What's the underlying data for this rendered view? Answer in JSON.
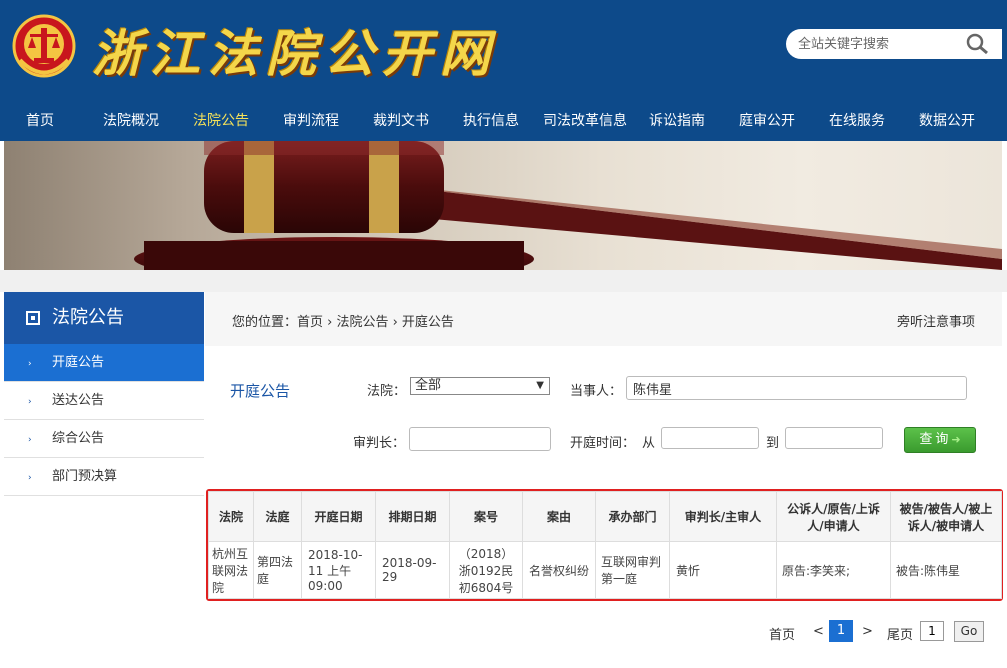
{
  "header": {
    "site_title": "浙江法院公开网",
    "search_placeholder": "全站关键字搜索"
  },
  "nav": [
    {
      "label": "首页"
    },
    {
      "label": "法院概况"
    },
    {
      "label": "法院公告",
      "active": true
    },
    {
      "label": "审判流程"
    },
    {
      "label": "裁判文书"
    },
    {
      "label": "执行信息"
    },
    {
      "label": "司法改革信息"
    },
    {
      "label": "诉讼指南"
    },
    {
      "label": "庭审公开"
    },
    {
      "label": "在线服务"
    },
    {
      "label": "数据公开"
    }
  ],
  "sidebar": {
    "title": "法院公告",
    "items": [
      {
        "label": "开庭公告",
        "active": true
      },
      {
        "label": "送达公告"
      },
      {
        "label": "综合公告"
      },
      {
        "label": "部门预决算"
      }
    ]
  },
  "breadcrumb": {
    "text": "您的位置：首页 › 法院公告 › 开庭公告",
    "notice": "旁听注意事项"
  },
  "form": {
    "title": "开庭公告",
    "court_label": "法院：",
    "court_value": "全部",
    "party_label": "当事人：",
    "party_value": "陈伟星",
    "judge_label": "审判长：",
    "judge_value": "",
    "date_label": "开庭时间：",
    "from_label": "从",
    "to_label": "到",
    "from_value": "",
    "to_value": "",
    "query_label": "查询"
  },
  "table": {
    "headers": [
      "法院",
      "法庭",
      "开庭日期",
      "排期日期",
      "案号",
      "案由",
      "承办部门",
      "审判长/主审人",
      "公诉人/原告/上诉人/申请人",
      "被告/被告人/被上诉人/被申请人"
    ],
    "rows": [
      [
        "杭州互联网法院",
        "第四法庭",
        "2018-10-11 上午09:00",
        "2018-09-29",
        "（2018）浙0192民初6804号",
        "名誉权纠纷",
        "互联网审判第一庭",
        "黄忻",
        "原告:李笑来;",
        "被告:陈伟星"
      ]
    ]
  },
  "pager": {
    "first": "首页",
    "prev": "<",
    "current": "1",
    "next": ">",
    "last": "尾页",
    "goto_value": "1",
    "go": "Go"
  },
  "colors": {
    "header_bg": "#0d4a8a",
    "nav_active": "#f5e25a",
    "accent": "#1b6fd2",
    "highlight_border": "#e02020",
    "query_button": "#4caf3a"
  }
}
